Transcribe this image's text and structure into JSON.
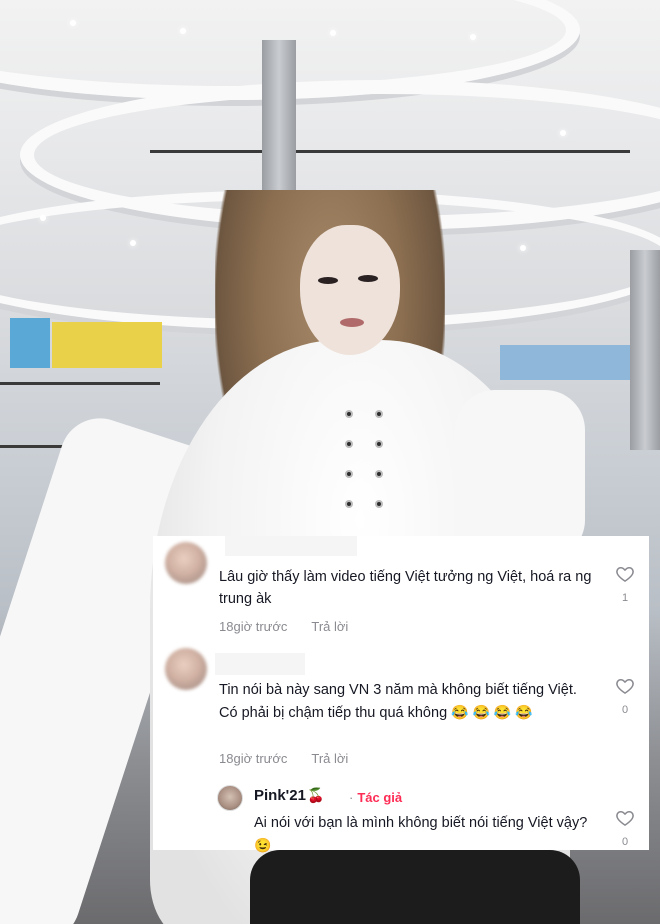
{
  "comments": [
    {
      "text": "Lâu giờ thấy làm video tiếng Việt tưởng ng Việt, hoá ra ng trung àk",
      "time": "18giờ trước",
      "reply_label": "Trả lời",
      "likes": "1"
    },
    {
      "text": "Tin nói bà này sang VN 3 năm mà không biết tiếng Việt. Có phải bị chậm tiếp thu quá không",
      "emojis": "😂 😂 😂 😂",
      "time": "18giờ trước",
      "reply_label": "Trả lời",
      "likes": "0"
    }
  ],
  "reply": {
    "username": "Pink'21",
    "username_emoji": "🍒",
    "separator": "·",
    "badge": "Tác giả",
    "text": "Ai nói với bạn là mình không biết nói tiếng Việt vậy?",
    "emoji": "😉",
    "likes": "0"
  },
  "icons": {
    "like": "heart-outline-icon"
  },
  "colors": {
    "author_badge": "#fe2c55",
    "text": "#161823",
    "meta": "#8a8b91"
  }
}
